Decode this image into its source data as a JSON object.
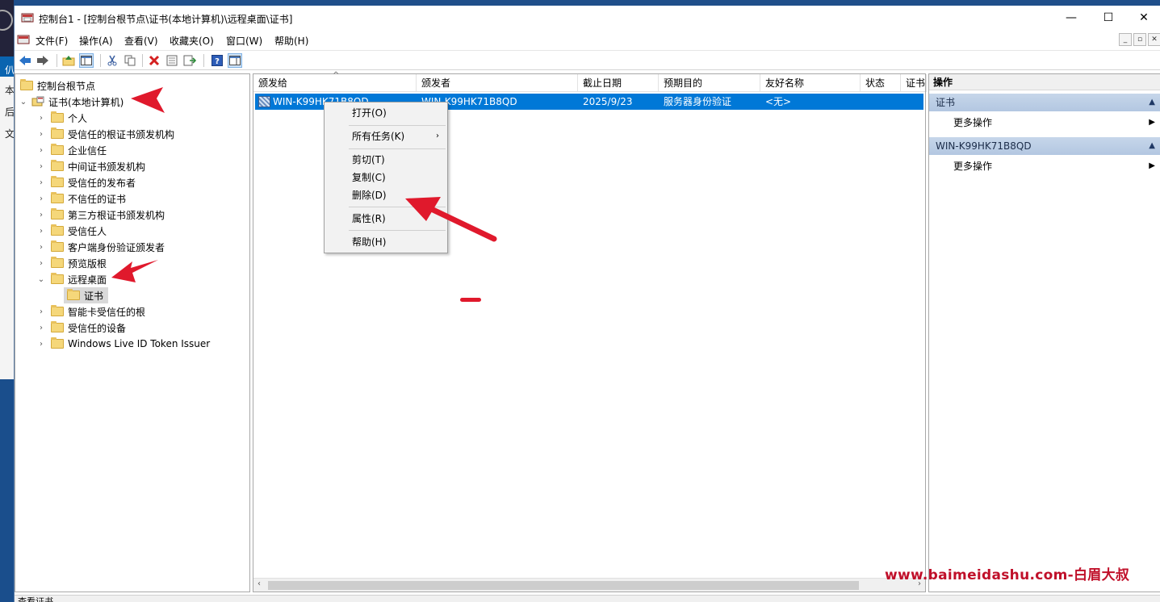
{
  "window": {
    "title": "控制台1 - [控制台根节点\\证书(本地计算机)\\远程桌面\\证书]",
    "minimize": "—",
    "maximize": "☐",
    "close": "✕"
  },
  "desktop": {
    "glyphs": [
      "仈",
      "本",
      "后",
      "文"
    ]
  },
  "menu": [
    "文件(F)",
    "操作(A)",
    "查看(V)",
    "收藏夹(O)",
    "窗口(W)",
    "帮助(H)"
  ],
  "tree": {
    "root": "控制台根节点",
    "store": "证书(本地计算机)",
    "children": [
      "个人",
      "受信任的根证书颁发机构",
      "企业信任",
      "中间证书颁发机构",
      "受信任的发布者",
      "不信任的证书",
      "第三方根证书颁发机构",
      "受信任人",
      "客户端身份验证颁发者",
      "预览版根",
      "远程桌面",
      "证书",
      "智能卡受信任的根",
      "受信任的设备",
      "Windows Live ID Token Issuer"
    ]
  },
  "list": {
    "columns": [
      "颁发给",
      "颁发者",
      "截止日期",
      "预期目的",
      "友好名称",
      "状态",
      "证书"
    ],
    "rows": [
      {
        "issued_to": "WIN-K99HK71B8QD",
        "issued_by": "WIN-K99HK71B8QD",
        "expiry": "2025/9/23",
        "purpose": "服务器身份验证",
        "friendly_name": "<无>",
        "status": ""
      }
    ]
  },
  "context_menu": {
    "open": "打开(O)",
    "all_tasks": "所有任务(K)",
    "cut": "剪切(T)",
    "copy": "复制(C)",
    "delete": "删除(D)",
    "properties": "属性(R)",
    "help": "帮助(H)"
  },
  "actions": {
    "header": "操作",
    "groups": [
      {
        "title": "证书",
        "item": "更多操作"
      },
      {
        "title": "WIN-K99HK71B8QD",
        "item": "更多操作"
      }
    ]
  },
  "status_text": "查看证书",
  "watermark": "www.baimeidashu.com-白眉大叔",
  "colors": {
    "selection": "#0078d7",
    "annotation_red": "#e0192c",
    "action_group": "#b3c7e1"
  }
}
